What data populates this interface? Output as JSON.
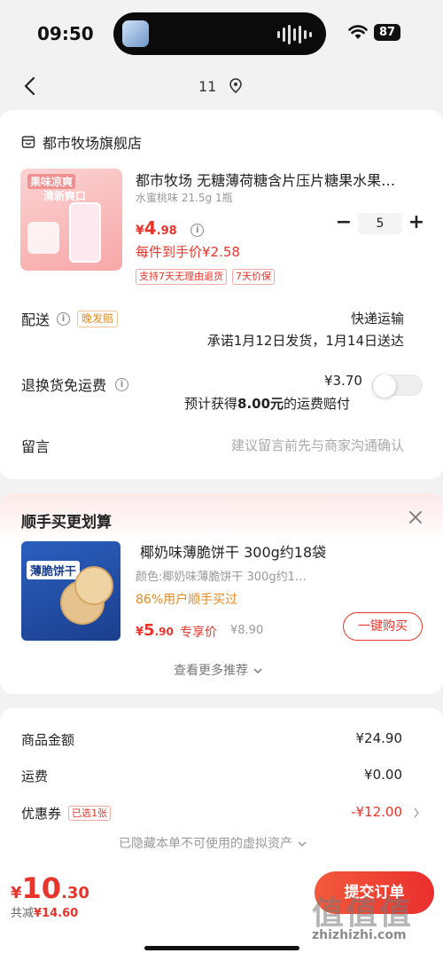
{
  "status_bar": {
    "time": "09:50",
    "battery": "87"
  },
  "nav": {
    "title": "11"
  },
  "store": {
    "name": "都市牧场旗舰店"
  },
  "product": {
    "title": "都市牧场 无糖薄荷糖含片压片糖果水果…",
    "spec": "水蜜桃味 21.5g 1瓶",
    "price_symbol": "¥",
    "price_int": "4",
    "price_dec": ".98",
    "quantity": "5",
    "unit_price": "每件到手价¥2.58",
    "tags": [
      "支持7天无理由退货",
      "7天价保"
    ],
    "image_text": [
      "果味凉爽",
      "清新爽口"
    ]
  },
  "delivery": {
    "label": "配送",
    "badge": "晚发赔",
    "method": "快递运输",
    "promise": "承诺1月12日发货，1月14日送达"
  },
  "return_shipping": {
    "label": "退换货免运费",
    "price": "¥3.70",
    "note_prefix": "预计获得",
    "note_amount": "8.00元",
    "note_suffix": "的运费赔付"
  },
  "message": {
    "label": "留言",
    "placeholder": "建议留言前先与商家沟通确认"
  },
  "upsell": {
    "title": "顺手买更划算",
    "product_title": "椰奶味薄脆饼干 300g约18袋",
    "spec": "颜色:椰奶味薄脆饼干 300g约1…",
    "percent": "86%用户顺手买过",
    "price_symbol": "¥",
    "price_int": "5",
    "price_dec": ".90",
    "vip_label": "专享价",
    "orig_price": "¥8.90",
    "buy_label": "一键购买",
    "more_label": "查看更多推荐",
    "image_text": "薄脆饼干"
  },
  "summary": {
    "goods_label": "商品金额",
    "goods_value": "¥24.90",
    "shipping_label": "运费",
    "shipping_value": "¥0.00",
    "coupon_label": "优惠券",
    "coupon_tag": "已选1张",
    "coupon_value": "-¥12.00",
    "hidden_note": "已隐藏本单不可使用的虚拟资产"
  },
  "footer": {
    "total_symbol": "¥",
    "total_int": "10",
    "total_dec": ".30",
    "saved_label": "共减",
    "saved_value": "¥14.60",
    "submit_label": "提交订单"
  },
  "watermark": {
    "logo": "值值值",
    "url": "zhizhizhi.com"
  },
  "colors": {
    "accent": "#e8352c",
    "orange": "#e58a1f",
    "bg": "#f2f2f2"
  }
}
